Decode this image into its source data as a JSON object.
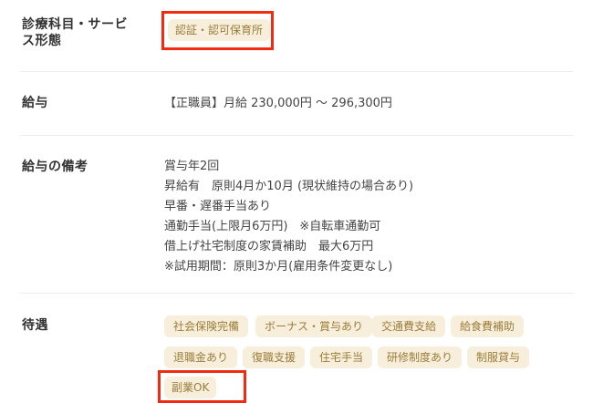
{
  "rows": {
    "service": {
      "label_line1": "診療科目・サービ",
      "label_line2": "ス形態",
      "tag": "認証・認可保育所"
    },
    "salary": {
      "label": "給与",
      "value": "【正職員】月給 230,000円 〜 296,300円"
    },
    "salary_notes": {
      "label": "給与の備考",
      "lines": [
        "賞与年2回",
        "昇給有　原則4月か10月 (現状維持の場合あり)",
        "早番・遅番手当あり",
        "通勤手当(上限月6万円)　※自転車通勤可",
        "借上げ社宅制度の家賃補助　最大6万円",
        "※試用期間：原則3か月(雇用条件変更なし)"
      ]
    },
    "benefits": {
      "label": "待遇",
      "tags": [
        "社会保険完備",
        "ボーナス・賞与あり",
        "交通費支給",
        "給食費補助",
        "退職金あり",
        "復職支援",
        "住宅手当",
        "研修制度あり",
        "制服貸与",
        "副業OK"
      ]
    }
  },
  "colors": {
    "tag_bg": "#f7efdc",
    "tag_text": "#9c7c3a",
    "highlight": "#f12a10"
  }
}
